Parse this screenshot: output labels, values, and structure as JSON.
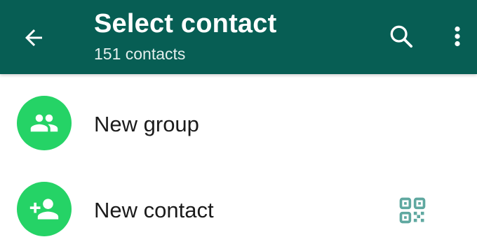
{
  "header": {
    "title": "Select contact",
    "subtitle": "151 contacts",
    "back_icon": "arrow-back-icon",
    "search_icon": "search-icon",
    "more_icon": "more-vert-icon",
    "background_color": "#075e54"
  },
  "actions": [
    {
      "label": "New group",
      "icon": "group-icon",
      "avatar_color": "#25d366"
    },
    {
      "label": "New contact",
      "icon": "add-person-icon",
      "avatar_color": "#25d366",
      "trailing_icon": "qr-code-icon",
      "trailing_icon_color": "#5fa8a0"
    }
  ]
}
